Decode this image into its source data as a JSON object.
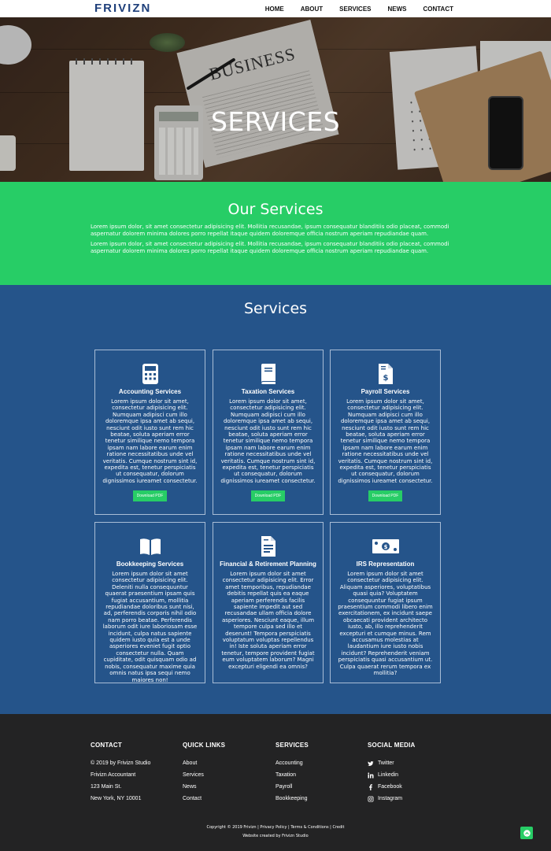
{
  "nav": {
    "brand": "FRIVIZN",
    "links": [
      "HOME",
      "ABOUT",
      "SERVICES",
      "NEWS",
      "CONTACT"
    ]
  },
  "hero": {
    "title": "SERVICES",
    "newspaper_headline": "BUSINESS"
  },
  "our_services": {
    "heading": "Our Services",
    "paragraphs": [
      "Lorem ipsum dolor, sit amet consectetur adipisicing elit. Mollitia recusandae, ipsum consequatur blanditiis odio placeat, commodi aspernatur dolorem minima dolores porro repellat itaque quidem doloremque officia nostrum aperiam repudiandae quam.",
      "Lorem ipsum dolor, sit amet consectetur adipisicing elit. Mollitia recusandae, ipsum consequatur blanditiis odio placeat, commodi aspernatur dolorem minima dolores porro repellat itaque quidem doloremque officia nostrum aperiam repudiandae quam."
    ]
  },
  "services": {
    "heading": "Services",
    "cards": [
      {
        "icon": "calculator-icon",
        "title": "Accounting Services",
        "text": "Lorem ipsum dolor sit amet, consectetur adipisicing elit. Numquam adipisci cum illo doloremque ipsa amet ab sequi, nesciunt odit iusto sunt rem hic beatae, soluta aperiam error tenetur similique nemo tempora ipsam nam labore earum enim ratione necessitatibus unde vel veritatis. Cumque nostrum sint id, expedita est, tenetur perspiciatis ut consequatur, dolorum dignissimos iureamet consectetur.",
        "button": "Download PDF"
      },
      {
        "icon": "book-icon",
        "title": "Taxation Services",
        "text": "Lorem ipsum dolor sit amet, consectetur adipisicing elit. Numquam adipisci cum illo doloremque ipsa amet ab sequi, nesciunt odit iusto sunt rem hic beatae, soluta aperiam error tenetur similique nemo tempora ipsam nam labore earum enim ratione necessitatibus unde vel veritatis. Cumque nostrum sint id, expedita est, tenetur perspiciatis ut consequatur, dolorum dignissimos iureamet consectetur.",
        "button": "Download PDF"
      },
      {
        "icon": "invoice-dollar-icon",
        "title": "Payroll Services",
        "text": "Lorem ipsum dolor sit amet, consectetur adipisicing elit. Numquam adipisci cum illo doloremque ipsa amet ab sequi, nesciunt odit iusto sunt rem hic beatae, soluta aperiam error tenetur similique nemo tempora ipsam nam labore earum enim ratione necessitatibus unde vel veritatis. Cumque nostrum sint id, expedita est, tenetur perspiciatis ut consequatur, dolorum dignissimos iureamet consectetur.",
        "button": "Download PDF"
      },
      {
        "icon": "open-book-icon",
        "title": "Bookkeeping Services",
        "text": "Lorem ipsum dolor sit amet consectetur adipisicing elit. Deleniti nulla consequuntur quaerat praesentium ipsam quis fugiat accusantium, mollitia repudiandae doloribus sunt nisi, ad, perferendis corporis nihil odio nam porro beatae. Perferendis laborum odit iure laboriosam esse incidunt, culpa natus sapiente quidem iusto quia est a unde asperiores eveniet fugit optio consectetur nulla. Quam cupiditate, odit quisquam odio ad nobis, consequatur maxime quia omnis natus ipsa sequi nemo maiores non!"
      },
      {
        "icon": "document-icon",
        "title": "Financial & Retirement Planning",
        "text": "Lorem ipsum dolor sit amet consectetur adipisicing elit. Error amet temporibus, repudiandae debitis repellat quis ea eaque aperiam perferendis facilis sapiente impedit aut sed recusandae ullam officia dolore asperiores. Nesciunt eaque, illum tempore culpa sed illo et deserunt! Tempora perspiciatis voluptatum voluptas repellendus in! Iste soluta aperiam error tenetur, tempore provident fugiat eum voluptatem laborum? Magni excepturi eligendi ea omnis?"
      },
      {
        "icon": "money-bill-icon",
        "title": "IRS Representation",
        "text": "Lorem ipsum dolor sit amet consectetur adipisicing elit. Aliquam asperiores, voluptatibus quasi quia? Voluptatem consequuntur fugiat ipsum praesentium commodi libero enim exercitationem, ex incidunt saepe obcaecati provident architecto iusto, ab, illo reprehenderit excepturi et cumque minus. Rem accusamus molestias at laudantium iure iusto nobis incidunt? Reprehenderit veniam perspiciatis quasi accusantium ut. Culpa quaerat rerum tempora ex mollitia?"
      }
    ]
  },
  "footer": {
    "contact": {
      "heading": "CONTACT",
      "lines": [
        "© 2019 by Frivizn Studio",
        "Frivizn Accountant",
        "123 Main St.",
        "New York, NY 10001"
      ]
    },
    "quick_links": {
      "heading": "QUICK LINKS",
      "items": [
        "About",
        "Services",
        "News",
        "Contact"
      ]
    },
    "services": {
      "heading": "SERVICES",
      "items": [
        "Accounting",
        "Taxation",
        "Payroll",
        "Bookkeeping"
      ]
    },
    "social": {
      "heading": "SOCIAL MEDIA",
      "items": [
        {
          "label": "Twitter",
          "icon": "twitter-icon"
        },
        {
          "label": "Linkedin",
          "icon": "linkedin-icon"
        },
        {
          "label": "Facebook",
          "icon": "facebook-icon"
        },
        {
          "label": "Instagram",
          "icon": "instagram-icon"
        }
      ]
    },
    "copyright": "Copyright © 2019 Frivizn | Privacy Policy | Terms & Conditions | Credit",
    "credit": "Website created by Frivizn Studio",
    "back_to_top_icon": "chevron-up-icon"
  },
  "colors": {
    "green": "#27cd66",
    "blue": "#25548a",
    "footer": "#232324",
    "brand": "#1e3f7a"
  }
}
